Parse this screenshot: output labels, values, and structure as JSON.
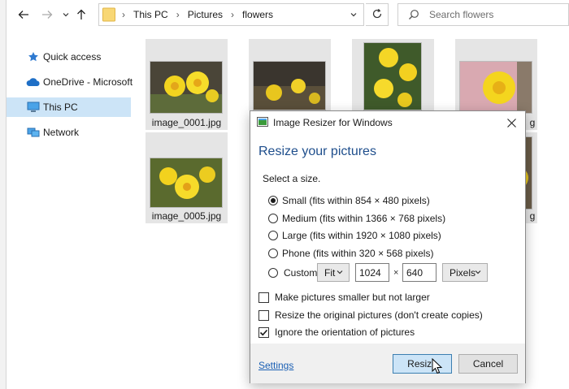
{
  "explorer": {
    "breadcrumb": [
      "This PC",
      "Pictures",
      "flowers"
    ],
    "search_placeholder": "Search flowers",
    "sidebar": [
      {
        "label": "Quick access",
        "icon": "star-icon"
      },
      {
        "label": "OneDrive - Microsoft",
        "icon": "cloud-icon"
      },
      {
        "label": "This PC",
        "icon": "monitor-icon",
        "selected": true
      },
      {
        "label": "Network",
        "icon": "network-icon"
      }
    ],
    "files": [
      {
        "caption": "image_0001.jpg"
      },
      {
        "caption": "image_0005.jpg"
      },
      {
        "caption": "g"
      },
      {
        "caption": "g"
      }
    ]
  },
  "dialog": {
    "title": "Image Resizer for Windows",
    "heading": "Resize your pictures",
    "prompt": "Select a size.",
    "sizes": [
      {
        "label": "Small (fits within 854 × 480 pixels)",
        "selected": true
      },
      {
        "label": "Medium (fits within 1366 × 768 pixels)",
        "selected": false
      },
      {
        "label": "Large (fits within 1920 × 1080 pixels)",
        "selected": false
      },
      {
        "label": "Phone (fits within 320 × 568 pixels)",
        "selected": false
      }
    ],
    "custom": {
      "label": "Custom",
      "selected": false,
      "mode": "Fit",
      "width": "1024",
      "times": "×",
      "height": "640",
      "unit": "Pixels"
    },
    "options": [
      {
        "label": "Make pictures smaller but not larger",
        "checked": false
      },
      {
        "label": "Resize the original pictures (don't create copies)",
        "checked": false
      },
      {
        "label": "Ignore the orientation of pictures",
        "checked": true
      }
    ],
    "footer": {
      "settings_link": "Settings",
      "resize_label": "Resize",
      "cancel_label": "Cancel"
    }
  },
  "colors": {
    "accent": "#1e4e8c",
    "selection": "#cce4f7",
    "link": "#1a5fb4"
  }
}
